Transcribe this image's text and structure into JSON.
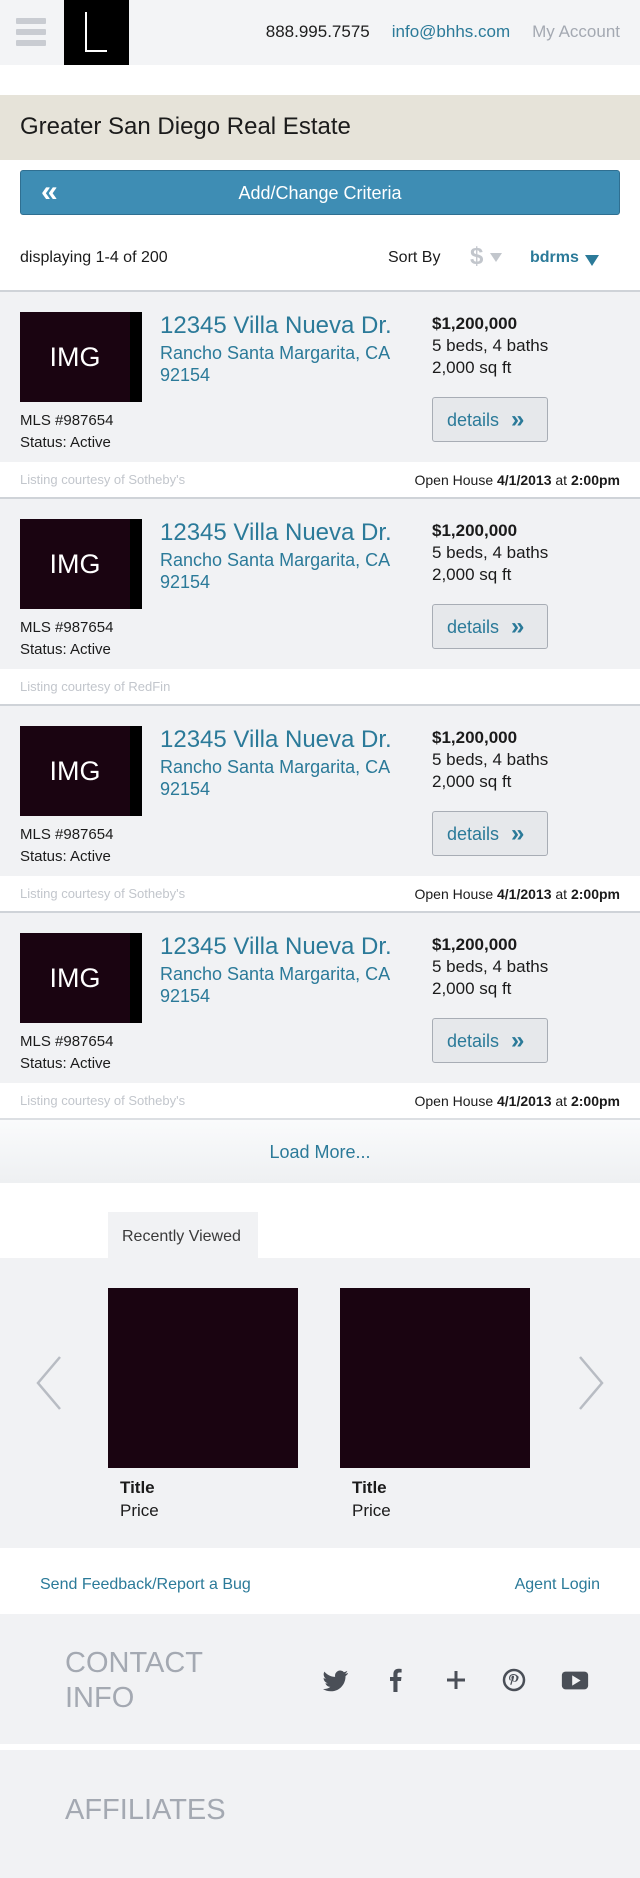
{
  "header": {
    "phone": "888.995.7575",
    "email": "info@bhhs.com",
    "account": "My Account"
  },
  "region": {
    "title": "Greater San Diego Real Estate"
  },
  "criteria": {
    "label": "Add/Change Criteria",
    "icon": "double-chevron-left-icon"
  },
  "results": {
    "displaying": "displaying 1-4 of 200",
    "sort_by": "Sort By",
    "sort_price_symbol": "$",
    "sort_bdrms": "bdrms"
  },
  "listings": [
    {
      "thumb": "IMG",
      "address": "12345 Villa Nueva Dr.",
      "city": "Rancho Santa Margarita, CA",
      "zip": "92154",
      "price": "$1,200,000",
      "beds_baths": "5 beds, 4 baths",
      "sqft": "2,000 sq ft",
      "mls": "MLS #987654",
      "status": "Status: Active",
      "details": "details",
      "courtesy": "Listing courtesy of Sotheby's",
      "open_house_prefix": "Open House",
      "open_house_date": "4/1/2013",
      "open_house_at": "at",
      "open_house_time": "2:00pm"
    },
    {
      "thumb": "IMG",
      "address": "12345 Villa Nueva Dr.",
      "city": "Rancho Santa Margarita, CA",
      "zip": "92154",
      "price": "$1,200,000",
      "beds_baths": "5 beds, 4 baths",
      "sqft": "2,000 sq ft",
      "mls": "MLS #987654",
      "status": "Status: Active",
      "details": "details",
      "courtesy": "Listing courtesy of RedFin",
      "open_house_prefix": "",
      "open_house_date": "",
      "open_house_at": "",
      "open_house_time": ""
    },
    {
      "thumb": "IMG",
      "address": "12345 Villa Nueva Dr.",
      "city": "Rancho Santa Margarita, CA",
      "zip": "92154",
      "price": "$1,200,000",
      "beds_baths": "5 beds, 4 baths",
      "sqft": "2,000 sq ft",
      "mls": "MLS #987654",
      "status": "Status: Active",
      "details": "details",
      "courtesy": "Listing courtesy of Sotheby's",
      "open_house_prefix": "Open House",
      "open_house_date": "4/1/2013",
      "open_house_at": "at",
      "open_house_time": "2:00pm"
    },
    {
      "thumb": "IMG",
      "address": "12345 Villa Nueva Dr.",
      "city": "Rancho Santa Margarita, CA",
      "zip": "92154",
      "price": "$1,200,000",
      "beds_baths": "5 beds, 4 baths",
      "sqft": "2,000 sq ft",
      "mls": "MLS #987654",
      "status": "Status: Active",
      "details": "details",
      "courtesy": "Listing courtesy of Sotheby's",
      "open_house_prefix": "Open House",
      "open_house_date": "4/1/2013",
      "open_house_at": "at",
      "open_house_time": "2:00pm"
    }
  ],
  "load_more": "Load More...",
  "recently_viewed": {
    "tab": "Recently Viewed",
    "items": [
      {
        "title": "Title",
        "price": "Price"
      },
      {
        "title": "Title",
        "price": "Price"
      }
    ]
  },
  "footer": {
    "feedback": "Send Feedback/Report a Bug",
    "agent_login": "Agent Login",
    "contact_title": "CONTACT INFO",
    "social_icons": [
      "twitter-icon",
      "facebook-icon",
      "plus-icon",
      "pinterest-icon",
      "youtube-icon"
    ],
    "affiliates_title": "AFFILIATES"
  },
  "colors": {
    "accent": "#2b7a99",
    "button_blue": "#3e8db4",
    "region_bg": "#e6e3d9",
    "panel_bg": "#f1f2f4",
    "image_placeholder": "#1a0411"
  }
}
